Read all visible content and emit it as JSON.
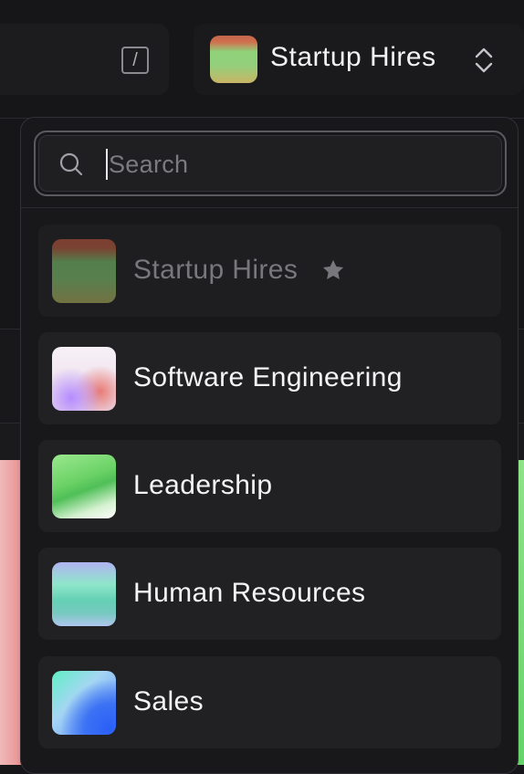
{
  "background": {
    "slash_key": "/",
    "workspace_switcher": {
      "current": "Startup Hires",
      "chevron": "chevron-up-down-icon"
    }
  },
  "dropdown": {
    "search": {
      "placeholder": "Search",
      "value": ""
    },
    "items": [
      {
        "label": "Startup Hires",
        "current": true,
        "badge": "star-icon"
      },
      {
        "label": "Software Engineering"
      },
      {
        "label": "Leadership"
      },
      {
        "label": "Human Resources"
      },
      {
        "label": "Sales"
      }
    ]
  },
  "colors": {
    "panel_bg": "#18181b",
    "item_bg": "#212124",
    "text_primary": "#f4f4f6",
    "text_muted": "#77777c",
    "border": "#5a5a60"
  }
}
